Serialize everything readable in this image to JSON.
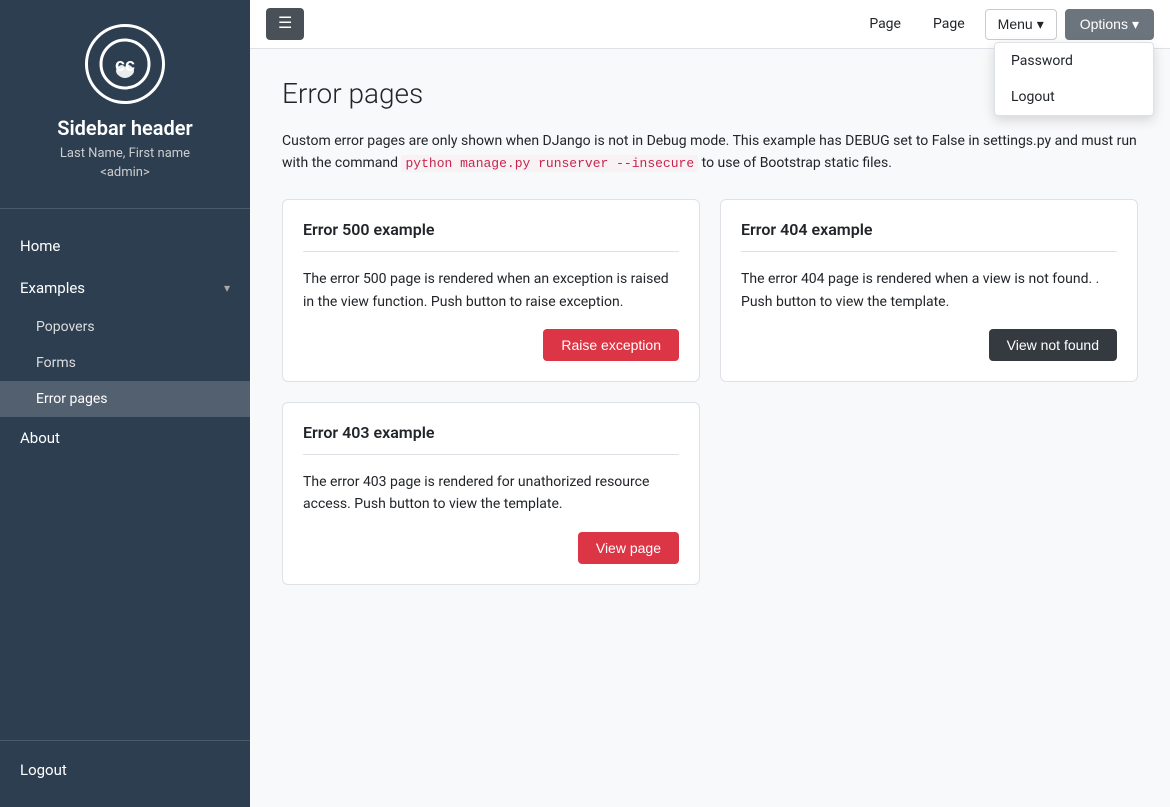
{
  "sidebar": {
    "header": "Sidebar header",
    "user": "Last Name, First name",
    "user_role": "<admin>",
    "logo_label": "CC logo",
    "nav": {
      "home": "Home",
      "examples": "Examples",
      "examples_sub": [
        {
          "label": "Popovers",
          "active": false
        },
        {
          "label": "Forms",
          "active": false
        },
        {
          "label": "Error pages",
          "active": true
        }
      ],
      "about": "About",
      "logout": "Logout"
    }
  },
  "navbar": {
    "toggler_label": "☰",
    "link1": "Page",
    "link2": "Page",
    "menu_label": "Menu",
    "options_label": "Options",
    "dropdown": {
      "password": "Password",
      "logout": "Logout"
    }
  },
  "page": {
    "title": "Error pages",
    "description_text": "Custom error pages are only shown when DJango is not in Debug mode. This example has DEBUG set to False in settings.py and must run with the command",
    "description_code": "python manage.py runserver --insecure",
    "description_suffix": "to use of Bootstrap static files.",
    "cards": [
      {
        "title": "Error 500 example",
        "body": "The error 500 page is rendered when an exception is raised in the view function. Push button to raise exception.",
        "button": "Raise exception"
      },
      {
        "title": "Error 404 example",
        "body": "The error 404 page is rendered when a view is not found. . Push button to view the template.",
        "button": "View not found"
      }
    ],
    "card_bottom": {
      "title": "Error 403 example",
      "body": "The error 403 page is rendered for unathorized resource access. Push button to view the template.",
      "button": "View page"
    }
  }
}
